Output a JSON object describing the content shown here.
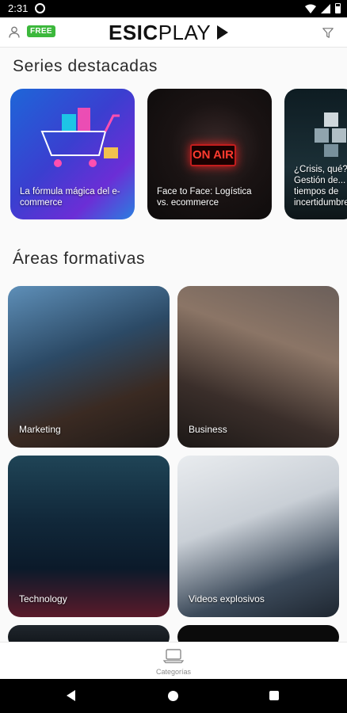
{
  "status_bar": {
    "time": "2:31"
  },
  "header": {
    "free_badge": "FREE",
    "logo_bold": "ESIC",
    "logo_light": "PLAY"
  },
  "sections": {
    "featured_title": "Series destacadas",
    "areas_title": "Áreas formativas"
  },
  "featured_series": [
    {
      "title": "La fórmula mágica del e-commerce"
    },
    {
      "title": "Face to Face: Logística vs. ecommerce"
    },
    {
      "title": "¿Crisis, qué? Gestión de... tiempos de incertidumbre"
    }
  ],
  "areas": [
    {
      "label": "Marketing"
    },
    {
      "label": "Business"
    },
    {
      "label": "Technology"
    },
    {
      "label": "Videos explosivos"
    }
  ],
  "bottom_nav": {
    "label": "Categorías"
  }
}
